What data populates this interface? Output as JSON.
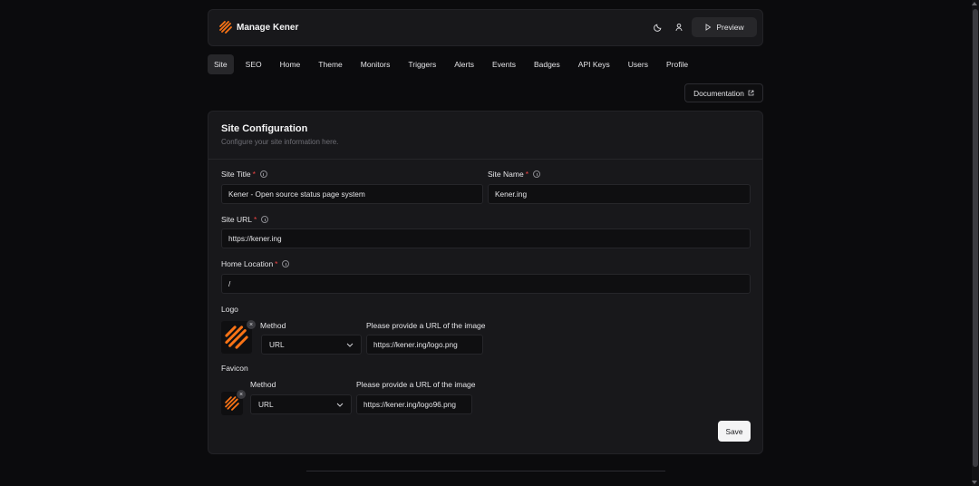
{
  "header": {
    "title": "Manage Kener",
    "preview_label": "Preview",
    "icons": [
      "moon-icon",
      "user-icon",
      "play-icon"
    ]
  },
  "tabs": [
    {
      "label": "Site",
      "active": true
    },
    {
      "label": "SEO"
    },
    {
      "label": "Home"
    },
    {
      "label": "Theme"
    },
    {
      "label": "Monitors"
    },
    {
      "label": "Triggers"
    },
    {
      "label": "Alerts"
    },
    {
      "label": "Events"
    },
    {
      "label": "Badges"
    },
    {
      "label": "API Keys"
    },
    {
      "label": "Users"
    },
    {
      "label": "Profile"
    }
  ],
  "documentation_label": "Documentation",
  "card": {
    "title": "Site Configuration",
    "subtitle": "Configure your site information here.",
    "site_title_label": "Site Title",
    "site_title_value": "Kener - Open source status page system",
    "site_name_label": "Site Name",
    "site_name_value": "Kener.ing",
    "site_url_label": "Site URL",
    "site_url_value": "https://kener.ing",
    "home_location_label": "Home Location",
    "home_location_value": "/",
    "required_mark": "*",
    "logo": {
      "label": "Logo",
      "method_label": "Method",
      "method_value": "URL",
      "url_label": "Please provide a URL of the image",
      "url_value": "https://kener.ing/logo.png"
    },
    "favicon": {
      "label": "Favicon",
      "method_label": "Method",
      "method_value": "URL",
      "url_label": "Please provide a URL of the image",
      "url_value": "https://kener.ing/logo96.png"
    },
    "save_label": "Save"
  },
  "colors": {
    "accent": "#f97316",
    "background": "#0b0b0d",
    "card": "#18181b",
    "required": "#ef4444"
  }
}
